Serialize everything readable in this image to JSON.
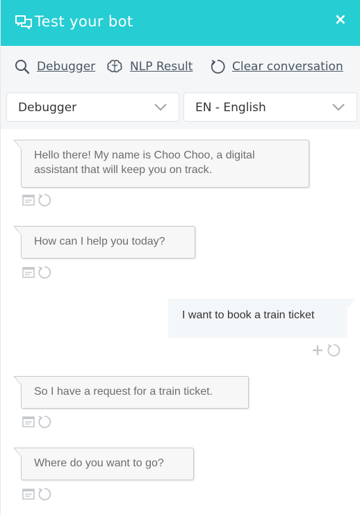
{
  "header": {
    "title": "Test your bot",
    "close_label": "×"
  },
  "toolbar": {
    "debugger_label": "Debugger",
    "nlp_label": "NLP Result",
    "clear_label": "Clear conversation"
  },
  "selects": {
    "mode_value": "Debugger",
    "language_value": "EN - English"
  },
  "messages": [
    {
      "from": "bot",
      "text": "Hello there! My name is Choo Choo, a digital assistant that will keep you on track."
    },
    {
      "from": "bot",
      "text": "How can I help you today?"
    },
    {
      "from": "user",
      "text": "I want to book a train ticket"
    },
    {
      "from": "bot",
      "text": "So I have a request for a train ticket."
    },
    {
      "from": "bot",
      "text": "Where do you want to go?"
    }
  ],
  "colors": {
    "header_bg": "#26cdd3",
    "toolbar_bg": "#f4f6f8",
    "bubble_bg": "#f7f7f7",
    "icon_gray": "#c4c8cc"
  }
}
